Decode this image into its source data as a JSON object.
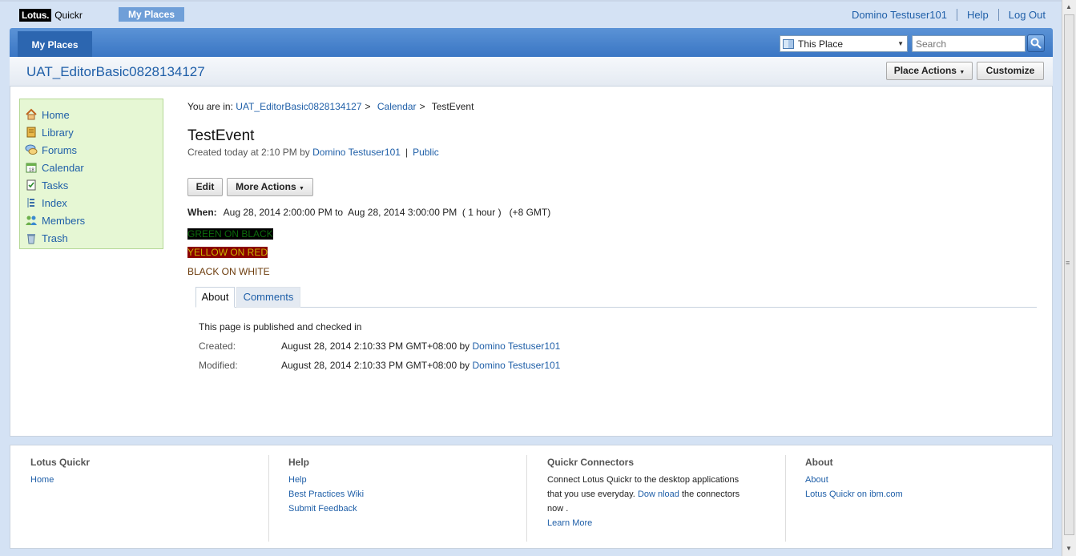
{
  "banner": {
    "logo_lotus": "Lotus.",
    "logo_quickr": "Quickr",
    "my_places_tab": "My Places",
    "user_link": "Domino Testuser101",
    "help_link": "Help",
    "logout_link": "Log Out"
  },
  "titlebar": {
    "tab_label": "My Places",
    "scope_select": "This Place",
    "search_placeholder": "Search"
  },
  "place": {
    "title": "UAT_EditorBasic0828134127",
    "place_actions": "Place Actions",
    "customize": "Customize"
  },
  "sidebar": {
    "items": [
      {
        "label": "Home",
        "icon": "home-icon"
      },
      {
        "label": "Library",
        "icon": "library-icon"
      },
      {
        "label": "Forums",
        "icon": "forums-icon"
      },
      {
        "label": "Calendar",
        "icon": "calendar-icon"
      },
      {
        "label": "Tasks",
        "icon": "tasks-icon"
      },
      {
        "label": "Index",
        "icon": "index-icon"
      },
      {
        "label": "Members",
        "icon": "members-icon"
      },
      {
        "label": "Trash",
        "icon": "trash-icon"
      }
    ]
  },
  "breadcrumb": {
    "prefix": "You are in:",
    "place": "UAT_EditorBasic0828134127",
    "section": "Calendar",
    "current": "TestEvent",
    "separator": ">"
  },
  "page": {
    "title": "TestEvent",
    "created_text": "Created today at 2:10 PM by",
    "author": "Domino Testuser101",
    "visibility": "Public",
    "edit": "Edit",
    "more_actions": "More Actions",
    "when_label": "When:",
    "when_value": "Aug 28, 2014 2:00:00 PM to  Aug 28, 2014 3:00:00 PM  ( 1 hour )   (+8 GMT)",
    "line_green": "GREEN ON BLACK",
    "line_yellow": "YELLOW ON RED",
    "line_black": "BLACK ON WHITE"
  },
  "tabs": {
    "about": "About",
    "comments": "Comments"
  },
  "about": {
    "status": "This page is published and checked in",
    "created_label": "Created:",
    "created_value": "August 28, 2014 2:10:33 PM GMT+08:00 by",
    "created_by": "Domino Testuser101",
    "modified_label": "Modified:",
    "modified_value": "August 28, 2014 2:10:33 PM GMT+08:00 by",
    "modified_by": "Domino Testuser101"
  },
  "footer": {
    "col1": {
      "title": "Lotus Quickr",
      "links": [
        "Home"
      ]
    },
    "col2": {
      "title": "Help",
      "links": [
        "Help",
        "Best Practices Wiki",
        "Submit Feedback"
      ]
    },
    "col3": {
      "title": "Quickr Connectors",
      "text_1": "Connect Lotus Quickr to the desktop applications",
      "text_2a": "that you use everyday.",
      "download": "Dow nload",
      "text_2b": "the connectors",
      "text_3": "now .",
      "learn_more": "Learn More"
    },
    "col4": {
      "title": "About",
      "links": [
        "About",
        "Lotus Quickr on ibm.com"
      ]
    }
  },
  "colors": {
    "link": "#1f5fa8",
    "titlebar": "#3a76c4",
    "sidebar_bg": "#e6f7d4"
  }
}
